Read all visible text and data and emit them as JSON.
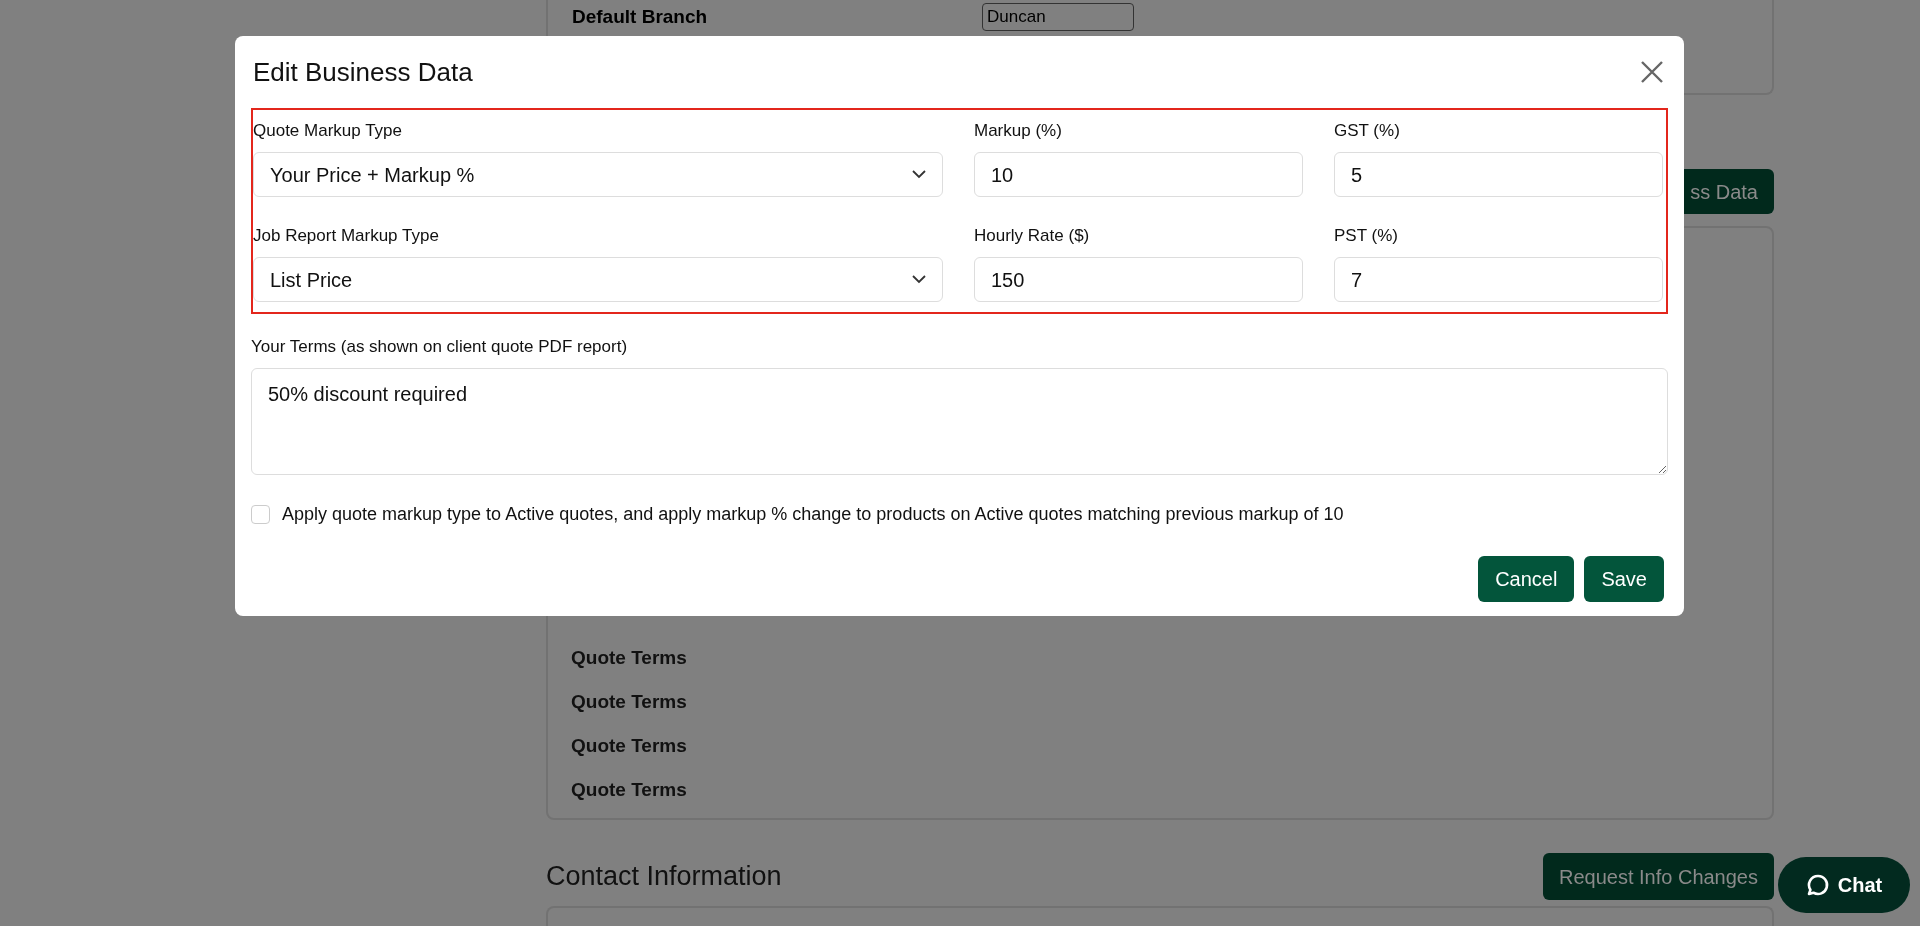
{
  "background": {
    "default_branch": {
      "label": "Default Branch",
      "value": "Duncan"
    },
    "header_button": "ss Data",
    "quote_terms": [
      "Quote Terms",
      "Quote Terms",
      "Quote Terms",
      "Quote Terms"
    ],
    "contact_heading": "Contact Information",
    "contact_button": "Request Info Changes"
  },
  "modal": {
    "title": "Edit Business Data",
    "highlighted": true,
    "fields": [
      {
        "kind": "select",
        "label": "Quote Markup Type",
        "value": "Your Price + Markup %"
      },
      {
        "kind": "input",
        "label": "Markup (%)",
        "value": "10"
      },
      {
        "kind": "input",
        "label": "GST (%)",
        "value": "5"
      },
      {
        "kind": "select",
        "label": "Job Report Markup Type",
        "value": "List Price"
      },
      {
        "kind": "input",
        "label": "Hourly Rate ($)",
        "value": "150"
      },
      {
        "kind": "input",
        "label": "PST (%)",
        "value": "7"
      }
    ],
    "terms": {
      "label": "Your Terms (as shown on client quote PDF report)",
      "value": "50% discount required"
    },
    "apply_option": {
      "label": "Apply quote markup type to Active quotes, and apply markup % change to products on Active quotes matching previous markup of 10",
      "checked": false
    },
    "buttons": [
      "Cancel",
      "Save"
    ]
  },
  "chat": {
    "label": "Chat"
  }
}
